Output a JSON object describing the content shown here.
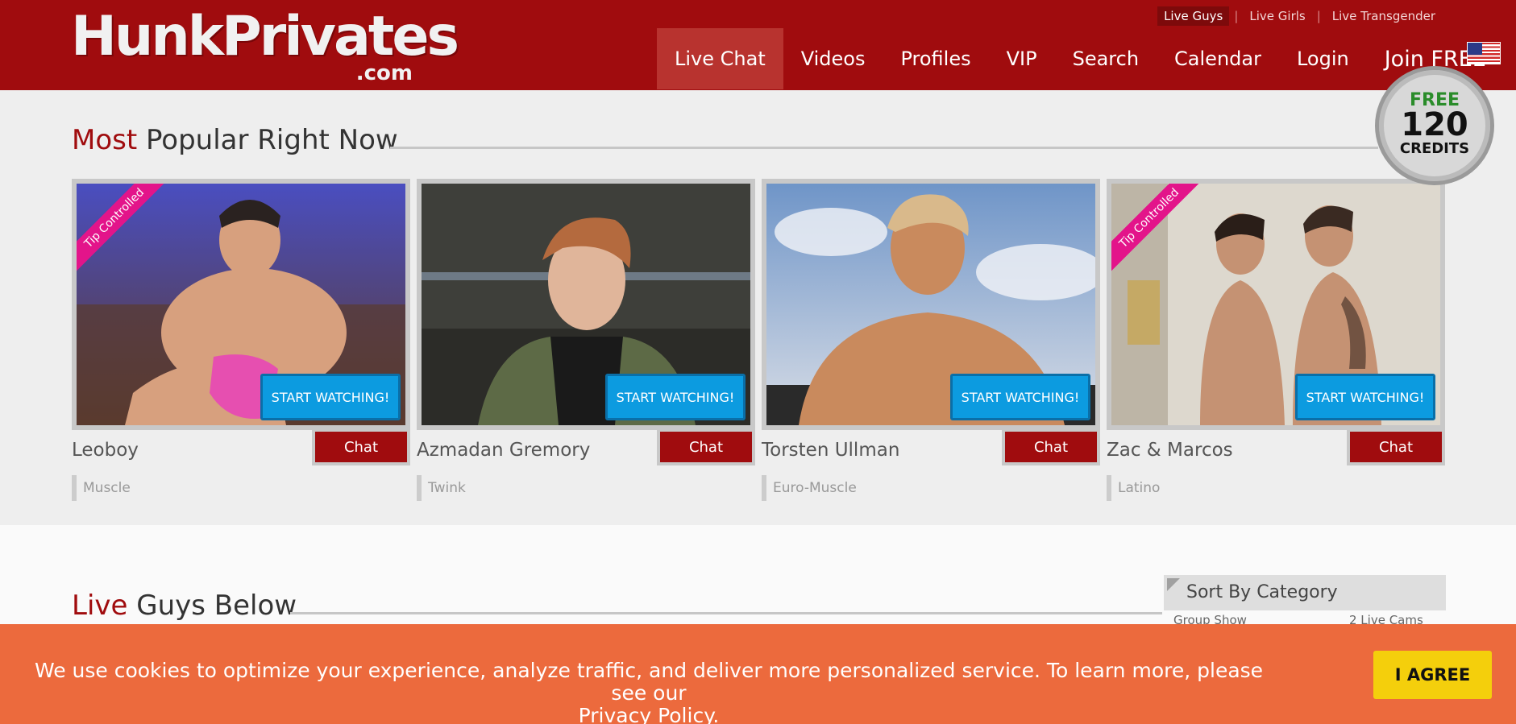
{
  "header": {
    "logo_main": "HunkPrivates",
    "logo_sub": ".com",
    "top_links": [
      {
        "label": "Live Guys",
        "active": true
      },
      {
        "label": "Live Girls",
        "active": false
      },
      {
        "label": "Live Transgender",
        "active": false
      }
    ],
    "nav": [
      {
        "label": "Live Chat",
        "active": true
      },
      {
        "label": "Videos",
        "active": false
      },
      {
        "label": "Profiles",
        "active": false
      },
      {
        "label": "VIP",
        "active": false
      },
      {
        "label": "Search",
        "active": false
      },
      {
        "label": "Calendar",
        "active": false
      },
      {
        "label": "Login",
        "active": false
      },
      {
        "label": "Join FREE",
        "active": false
      }
    ],
    "flag_icon": "us-flag-icon"
  },
  "badge": {
    "free": "FREE",
    "amount": "120",
    "credits": "CREDITS"
  },
  "popular": {
    "title_accent": "Most",
    "title_rest": "Popular Right Now",
    "cards": [
      {
        "name": "Leoboy",
        "category": "Muscle",
        "ribbon": "Tip Controlled",
        "watch_label": "START WATCHING!",
        "chat_label": "Chat",
        "colors": {
          "bg_top": "#4a4ec0",
          "bg_bottom": "#5a3a2e",
          "skin": "#d7a07e",
          "accent": "#e64fb0"
        }
      },
      {
        "name": "Azmadan Gremory",
        "category": "Twink",
        "ribbon": "",
        "watch_label": "START WATCHING!",
        "chat_label": "Chat",
        "colors": {
          "bg_top": "#3e3f3a",
          "bg_bottom": "#2c2c28",
          "skin": "#e0b59a",
          "accent": "#5d6a46"
        }
      },
      {
        "name": "Torsten Ullman",
        "category": "Euro-Muscle",
        "ribbon": "",
        "watch_label": "START WATCHING!",
        "chat_label": "Chat",
        "colors": {
          "bg_top": "#6f95c8",
          "bg_bottom": "#d8dde6",
          "skin": "#c98a5d",
          "accent": "#2a2a2a"
        }
      },
      {
        "name": "Zac & Marcos",
        "category": "Latino",
        "ribbon": "Tip Controlled",
        "watch_label": "START WATCHING!",
        "chat_label": "Chat",
        "colors": {
          "bg_top": "#ddd8ce",
          "bg_bottom": "#bdb5a6",
          "skin": "#c59273",
          "accent": "#3a2a22"
        }
      }
    ]
  },
  "live": {
    "title_accent": "Live",
    "title_rest": "Guys Below"
  },
  "sort": {
    "title": "Sort By Category",
    "rows": [
      {
        "label": "Group Show",
        "count": "2 Live Cams"
      }
    ]
  },
  "cookie": {
    "text": "We use cookies to optimize your experience, analyze traffic, and deliver more personalized service. To learn more, please see our",
    "link": "Privacy Policy.",
    "agree": "I AGREE"
  }
}
